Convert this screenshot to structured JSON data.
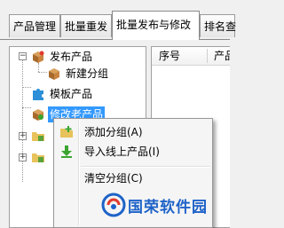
{
  "tabs": [
    {
      "label": "产品管理"
    },
    {
      "label": "批量重发"
    },
    {
      "label": "批量发布与修改"
    },
    {
      "label": "排名查"
    }
  ],
  "tree": {
    "nodes": [
      {
        "label": "发布产品",
        "icon": "box-icon",
        "expanded": true
      },
      {
        "label": "新建分组",
        "icon": "box-icon"
      },
      {
        "label": "模板产品",
        "icon": "puzzle-icon"
      },
      {
        "label": "修改老产品",
        "icon": "box-icon",
        "selected": true
      },
      {
        "label": "",
        "icon": "folder-icon",
        "expanded": false
      },
      {
        "label": "",
        "icon": "folder-icon",
        "expanded": false
      }
    ]
  },
  "list": {
    "columns": [
      "序号",
      "产品"
    ]
  },
  "context_menu": {
    "items": [
      {
        "label": "添加分组(A)",
        "icon": "add-group-icon"
      },
      {
        "label": "导入线上产品(I)",
        "icon": "import-icon"
      },
      {
        "label": "清空分组(C)",
        "icon": ""
      }
    ]
  },
  "watermark": {
    "text": "国荣软件园"
  },
  "colors": {
    "selection": "#3399ff",
    "watermark": "#1e63c8",
    "import_arrow": "#3aa52f"
  }
}
